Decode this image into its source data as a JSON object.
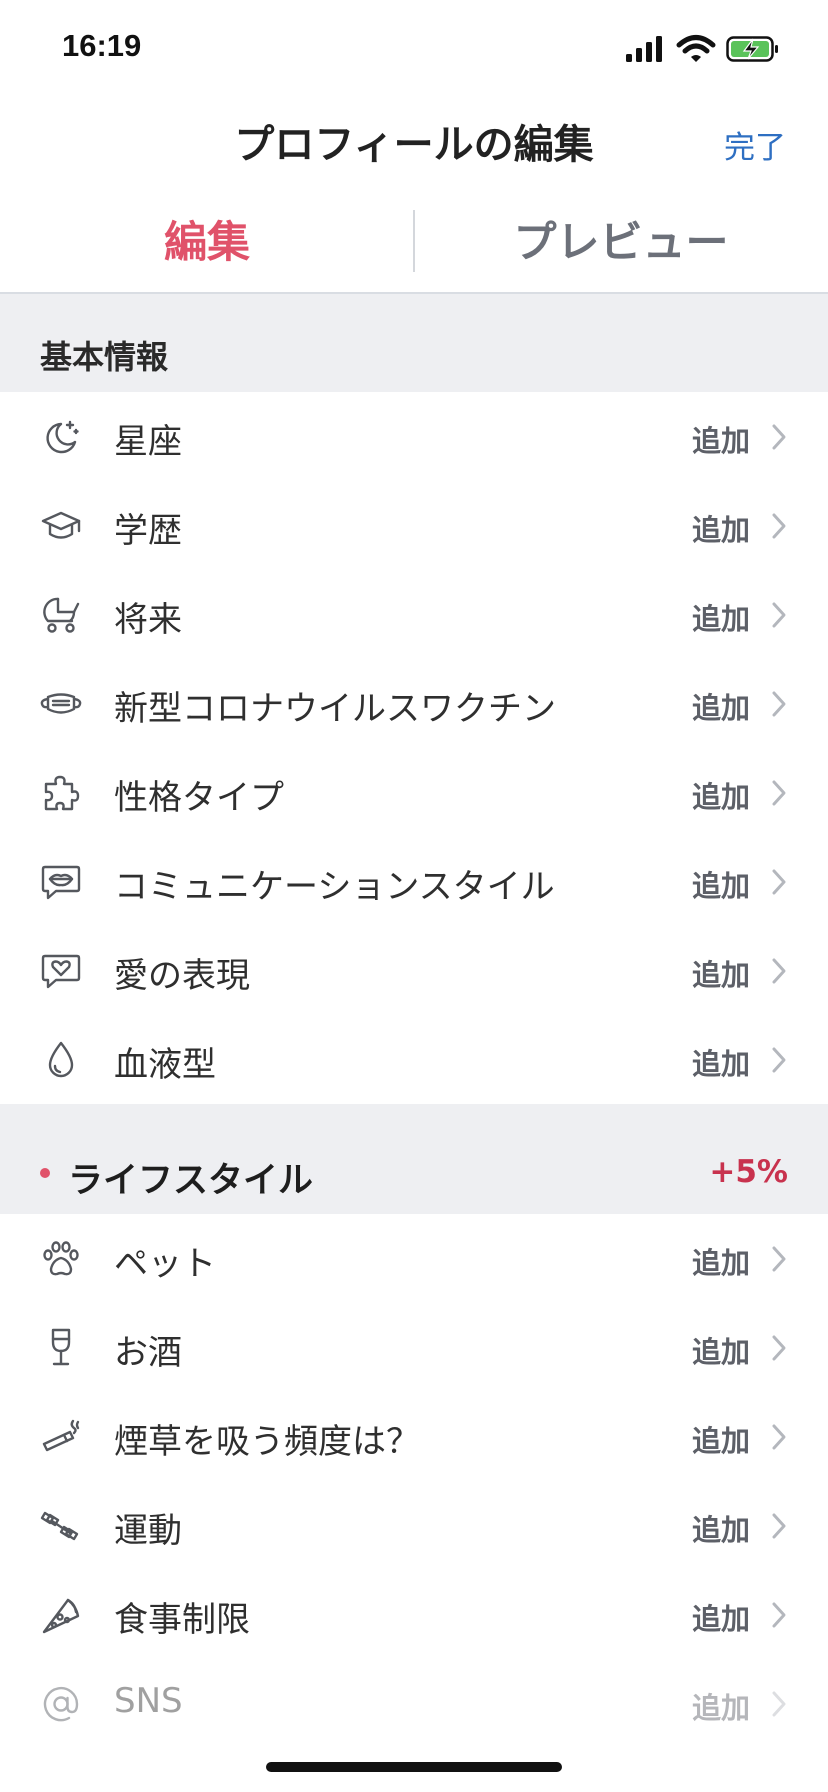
{
  "status_bar": {
    "time": "16:19"
  },
  "header": {
    "title": "プロフィールの編集",
    "done_label": "完了"
  },
  "tabs": [
    {
      "label": "編集",
      "active": true
    },
    {
      "label": "プレビュー",
      "active": false
    }
  ],
  "sections": {
    "basic": {
      "title": "基本情報",
      "items": [
        {
          "label": "星座",
          "action": "追加",
          "icon": "moon-stars-icon"
        },
        {
          "label": "学歴",
          "action": "追加",
          "icon": "graduation-cap-icon"
        },
        {
          "label": "将来",
          "action": "追加",
          "icon": "stroller-icon"
        },
        {
          "label": "新型コロナウイルスワクチン",
          "action": "追加",
          "icon": "mask-icon"
        },
        {
          "label": "性格タイプ",
          "action": "追加",
          "icon": "puzzle-icon"
        },
        {
          "label": "コミュニケーションスタイル",
          "action": "追加",
          "icon": "chat-lips-icon"
        },
        {
          "label": "愛の表現",
          "action": "追加",
          "icon": "chat-heart-icon"
        },
        {
          "label": "血液型",
          "action": "追加",
          "icon": "drop-icon"
        }
      ]
    },
    "lifestyle": {
      "title": "ライフスタイル",
      "bonus": "+5%",
      "items": [
        {
          "label": "ペット",
          "action": "追加",
          "icon": "paw-icon"
        },
        {
          "label": "お酒",
          "action": "追加",
          "icon": "wine-glass-icon"
        },
        {
          "label": "煙草を吸う頻度は？",
          "action": "追加",
          "icon": "cigarette-icon"
        },
        {
          "label": "運動",
          "action": "追加",
          "icon": "dumbbell-icon"
        },
        {
          "label": "食事制限",
          "action": "追加",
          "icon": "pizza-icon"
        },
        {
          "label": "SNS",
          "action": "追加",
          "icon": "at-sign-icon"
        }
      ]
    }
  },
  "colors": {
    "accent": "#e0526a",
    "done_blue": "#2e6fc2",
    "bonus_red": "#c8324e",
    "section_bg": "#eeeff2"
  }
}
